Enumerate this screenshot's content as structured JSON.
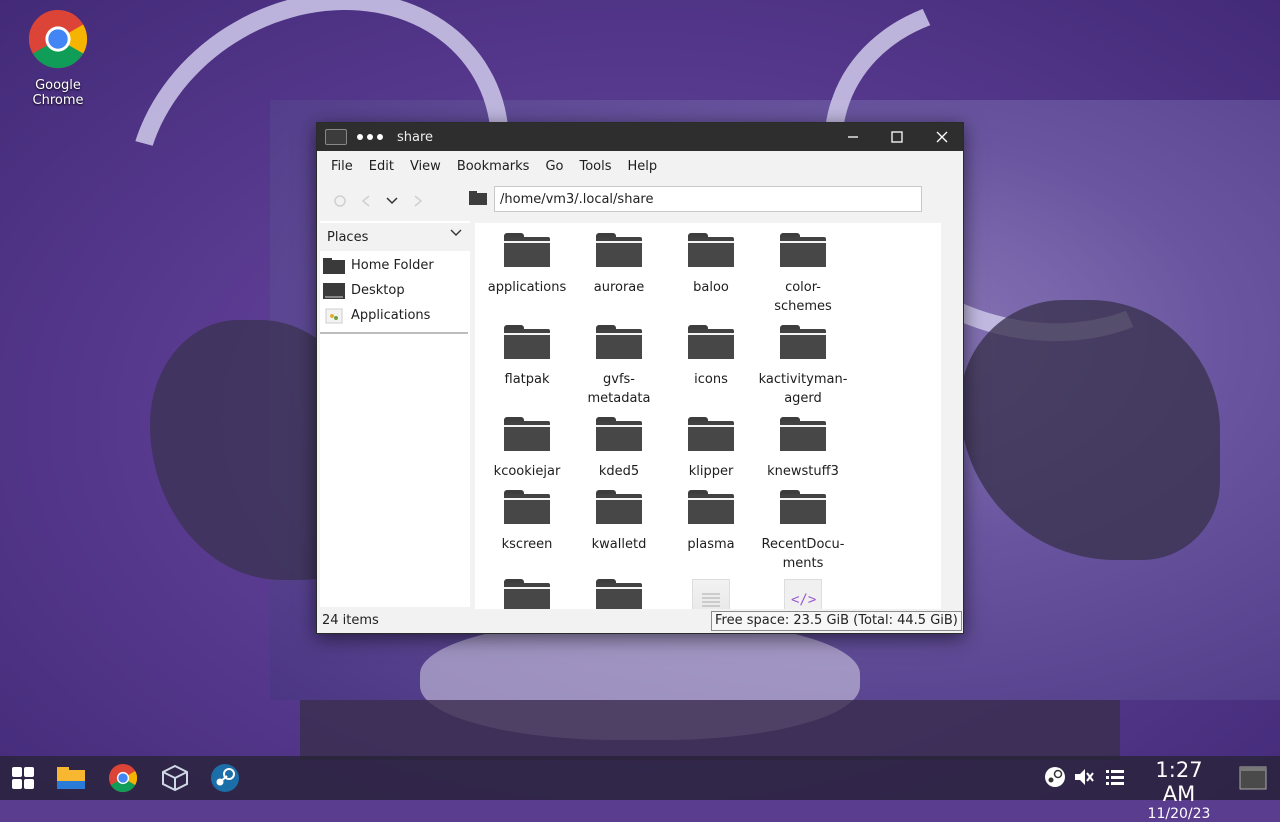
{
  "desktop": {
    "icons": [
      {
        "label": "Google Chrome",
        "icon": "chrome-icon"
      }
    ]
  },
  "window": {
    "title": "share",
    "menu": [
      "File",
      "Edit",
      "View",
      "Bookmarks",
      "Go",
      "Tools",
      "Help"
    ],
    "path": "/home/vm3/.local/share",
    "sidebar": {
      "header": "Places",
      "items": [
        {
          "label": "Home Folder",
          "icon": "home-folder-icon"
        },
        {
          "label": "Desktop",
          "icon": "desktop-icon"
        },
        {
          "label": "Applications",
          "icon": "applications-icon"
        }
      ]
    },
    "items": [
      {
        "name": "applications",
        "icon": "folder-icon"
      },
      {
        "name": "aurorae",
        "icon": "folder-icon"
      },
      {
        "name": "baloo",
        "icon": "folder-icon"
      },
      {
        "name": "color-\nschemes",
        "icon": "folder-icon"
      },
      {
        "name": "flatpak",
        "icon": "folder-icon"
      },
      {
        "name": "gvfs-\nmetadata",
        "icon": "folder-icon"
      },
      {
        "name": "icons",
        "icon": "folder-icon"
      },
      {
        "name": "kactivityman-\nagerd",
        "icon": "folder-icon"
      },
      {
        "name": "kcookiejar",
        "icon": "folder-icon"
      },
      {
        "name": "kded5",
        "icon": "folder-icon"
      },
      {
        "name": "klipper",
        "icon": "folder-icon"
      },
      {
        "name": "knewstuff3",
        "icon": "folder-icon"
      },
      {
        "name": "kscreen",
        "icon": "folder-icon"
      },
      {
        "name": "kwalletd",
        "icon": "folder-icon"
      },
      {
        "name": "plasma",
        "icon": "folder-icon"
      },
      {
        "name": "RecentDocu-\nments",
        "icon": "folder-icon"
      },
      {
        "name": "",
        "icon": "folder-icon"
      },
      {
        "name": "",
        "icon": "folder-icon"
      },
      {
        "name": "",
        "icon": "text-file-icon"
      },
      {
        "name": "",
        "icon": "xml-file-icon"
      }
    ],
    "status": {
      "count": "24 items",
      "free_space": "Free space: 23.5 GiB (Total: 44.5 GiB)"
    }
  },
  "taskbar": {
    "apps": [
      "start-menu-icon",
      "file-manager-icon",
      "chrome-icon",
      "virtualbox-icon",
      "steam-icon"
    ],
    "tray": [
      "steam-tray-icon",
      "volume-muted-icon",
      "menu-list-icon"
    ],
    "time": "1:27 AM",
    "date": "11/20/23"
  }
}
